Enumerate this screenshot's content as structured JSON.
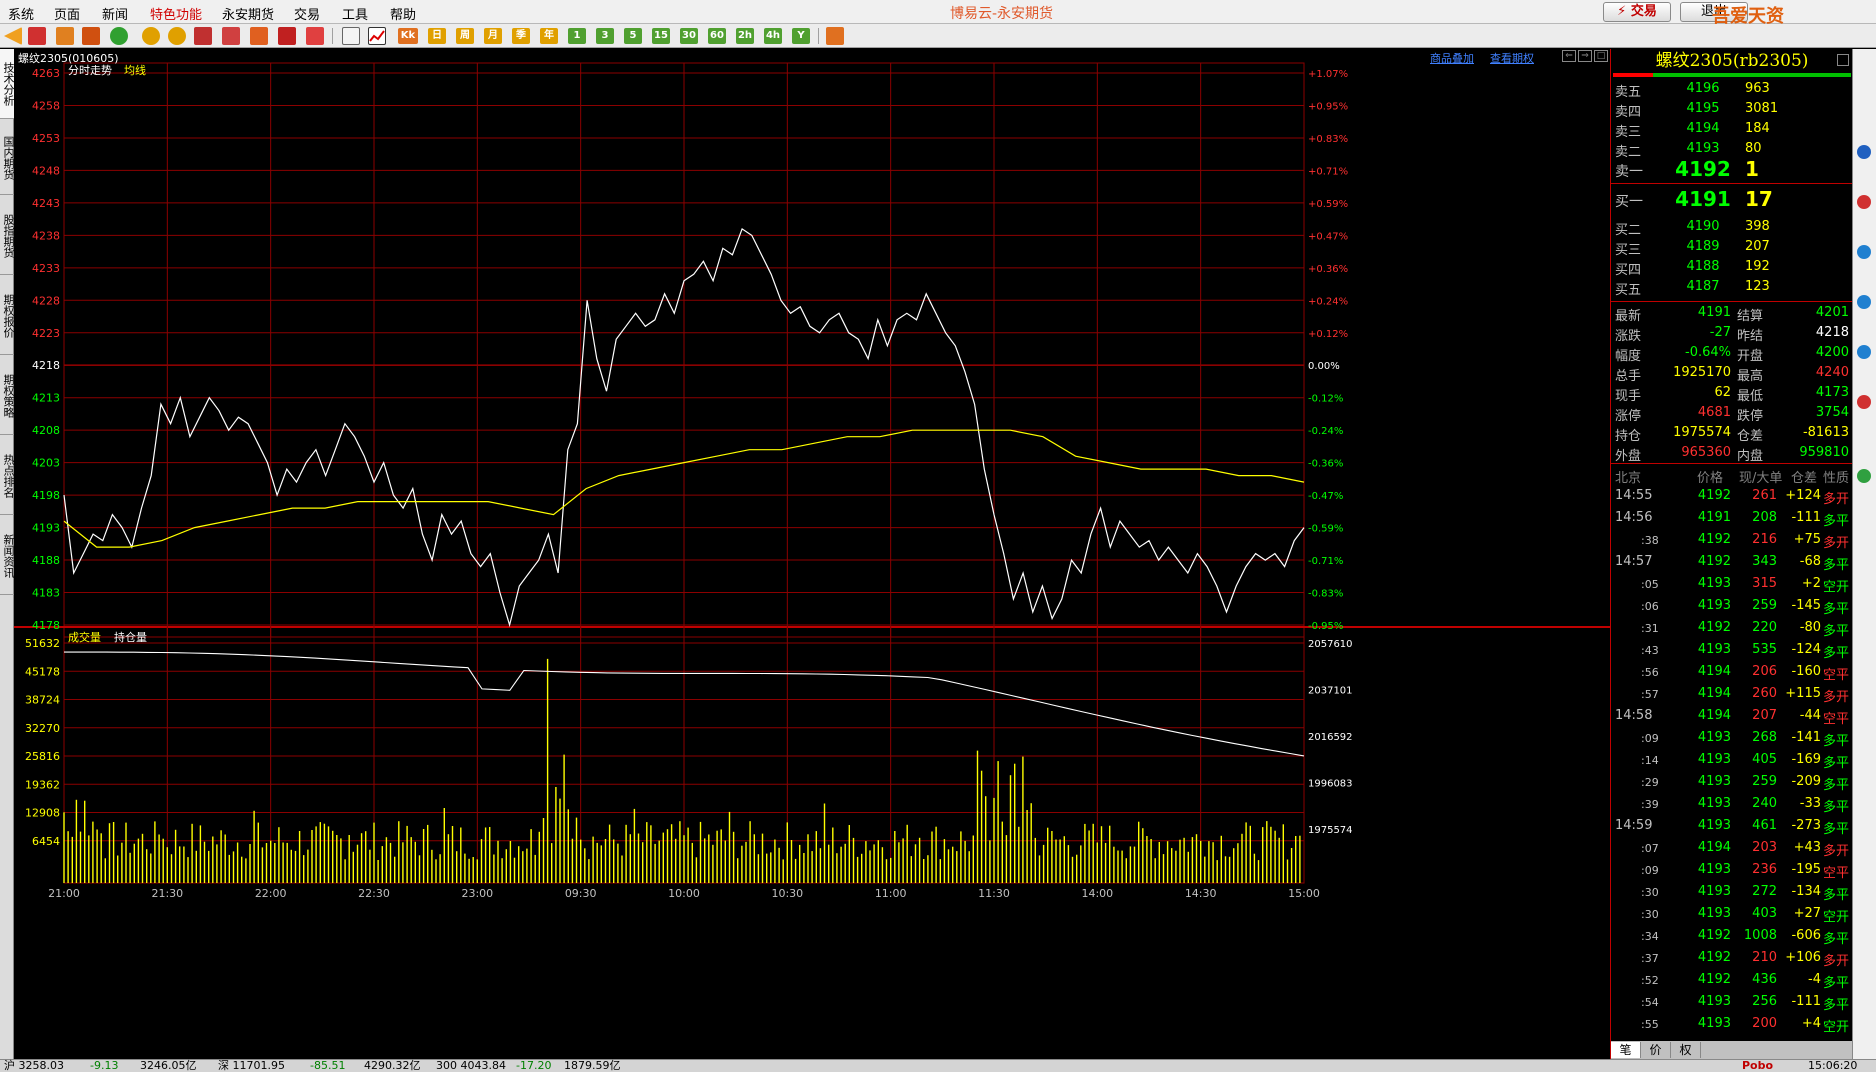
{
  "menu": {
    "items": [
      "系统",
      "页面",
      "新闻",
      "特色功能",
      "永安期货",
      "交易",
      "工具",
      "帮助"
    ],
    "active_index": 3
  },
  "app_title": "博易云-永安期货",
  "trade_button": "⚡ 交易",
  "user_button": "退出",
  "watermark": "吾爱天资5etz.com",
  "toolbar": {
    "icons": [
      "back-arrow-icon",
      "home-icon",
      "layers-icon",
      "table-icon",
      "refresh-icon",
      "zoom-in-icon",
      "zoom-out-icon",
      "window-icon",
      "pen-icon",
      "eraser-icon",
      "filter-icon",
      "bell-icon",
      "list-icon",
      "chart-line-icon",
      "kline-icon",
      "calendar-icon"
    ],
    "period_labels": [
      "日",
      "周",
      "月",
      "季",
      "年",
      "1",
      "3",
      "5",
      "15",
      "30",
      "60",
      "2h",
      "4h",
      "Y"
    ]
  },
  "left_tabs": [
    "技术分析",
    "国内期货",
    "股指期货",
    "期权报价",
    "期权策略",
    "热点排名",
    "新闻资讯"
  ],
  "chart": {
    "symbol_label": "螺纹2305(010605)",
    "links": [
      "商品叠加",
      "查看期权"
    ],
    "upper_legend": [
      "分时走势",
      "均线"
    ],
    "lower_legend": [
      "成交量",
      "持仓量"
    ],
    "price_ticks": [
      "4263",
      "4258",
      "4253",
      "4248",
      "4243",
      "4238",
      "4233",
      "4228",
      "4223",
      "4218",
      "4213",
      "4208",
      "4203",
      "4198",
      "4193",
      "4188",
      "4183",
      "4178"
    ],
    "pct_ticks": [
      "+1.07%",
      "+0.95%",
      "+0.83%",
      "+0.71%",
      "+0.59%",
      "+0.47%",
      "+0.36%",
      "+0.24%",
      "+0.12%",
      "0.00%",
      "-0.12%",
      "-0.24%",
      "-0.36%",
      "-0.47%",
      "-0.59%",
      "-0.71%",
      "-0.83%",
      "-0.95%"
    ],
    "vol_ticks": [
      "51632",
      "45178",
      "38724",
      "32270",
      "25816",
      "19362",
      "12908",
      "6454"
    ],
    "oi_ticks": [
      "2057610",
      "2037101",
      "2016592",
      "1996083",
      "1975574"
    ],
    "time_labels": [
      "21:00",
      "21:30",
      "22:00",
      "22:30",
      "23:00",
      "09:30",
      "10:00",
      "10:30",
      "11:00",
      "11:30",
      "14:00",
      "14:30",
      "15:00"
    ]
  },
  "chart_data": {
    "type": "line",
    "title": "螺纹2305(010605)",
    "prev_settle": 4218,
    "ylim": [
      4178,
      4263
    ],
    "series": [
      {
        "name": "分时走势",
        "values": [
          4198,
          4186,
          4189,
          4192,
          4191,
          4195,
          4193,
          4190,
          4196,
          4201,
          4212,
          4209,
          4213,
          4207,
          4210,
          4213,
          4211,
          4208,
          4210,
          4209,
          4206,
          4203,
          4198,
          4202,
          4200,
          4203,
          4205,
          4201,
          4205,
          4209,
          4207,
          4204,
          4200,
          4203,
          4198,
          4196,
          4199,
          4192,
          4188,
          4195,
          4192,
          4194,
          4189,
          4187,
          4189,
          4183,
          4178,
          4184,
          4186,
          4188,
          4192,
          4186,
          4205,
          4209,
          4228,
          4219,
          4214,
          4222,
          4224,
          4226,
          4224,
          4225,
          4229,
          4226,
          4231,
          4232,
          4234,
          4231,
          4236,
          4235,
          4239,
          4238,
          4235,
          4232,
          4228,
          4226,
          4227,
          4224,
          4223,
          4225,
          4226,
          4223,
          4222,
          4219,
          4225,
          4221,
          4225,
          4226,
          4225,
          4229,
          4226,
          4223,
          4221,
          4217,
          4212,
          4202,
          4195,
          4189,
          4182,
          4186,
          4180,
          4184,
          4179,
          4182,
          4188,
          4186,
          4192,
          4196,
          4190,
          4194,
          4192,
          4190,
          4191,
          4188,
          4190,
          4188,
          4186,
          4189,
          4187,
          4184,
          4180,
          4184,
          4187,
          4189,
          4188,
          4189,
          4187,
          4191,
          4193
        ]
      },
      {
        "name": "均线",
        "values": [
          4194,
          4190,
          4190,
          4191,
          4193,
          4194,
          4195,
          4196,
          4196,
          4197,
          4197,
          4197,
          4197,
          4197,
          4196,
          4195,
          4199,
          4201,
          4202,
          4203,
          4204,
          4205,
          4205,
          4206,
          4207,
          4207,
          4208,
          4208,
          4208,
          4208,
          4207,
          4204,
          4203,
          4202,
          4202,
          4202,
          4201,
          4201,
          4200
        ]
      }
    ],
    "volume_ylim": [
      0,
      51632
    ],
    "open_interest_ylim": [
      1975574,
      2057610
    ],
    "x_labels": [
      "21:00",
      "21:30",
      "22:00",
      "22:30",
      "23:00",
      "09:30",
      "10:00",
      "10:30",
      "11:00",
      "11:30",
      "14:00",
      "14:30",
      "15:00"
    ]
  },
  "quote": {
    "title": "螺纹2305(rb2305)",
    "asks": [
      {
        "label": "卖五",
        "price": "4196",
        "vol": "963"
      },
      {
        "label": "卖四",
        "price": "4195",
        "vol": "3081"
      },
      {
        "label": "卖三",
        "price": "4194",
        "vol": "184"
      },
      {
        "label": "卖二",
        "price": "4193",
        "vol": "80"
      },
      {
        "label": "卖一",
        "price": "4192",
        "vol": "1"
      }
    ],
    "bids": [
      {
        "label": "买一",
        "price": "4191",
        "vol": "17"
      },
      {
        "label": "买二",
        "price": "4190",
        "vol": "398"
      },
      {
        "label": "买三",
        "price": "4189",
        "vol": "207"
      },
      {
        "label": "买四",
        "price": "4188",
        "vol": "192"
      },
      {
        "label": "买五",
        "price": "4187",
        "vol": "123"
      }
    ],
    "stats": [
      {
        "l1": "最新",
        "v1": "4191",
        "c1": "#00ff00",
        "l2": "结算",
        "v2": "4201",
        "c2": "#00ff00"
      },
      {
        "l1": "涨跌",
        "v1": "-27",
        "c1": "#00ff00",
        "l2": "昨结",
        "v2": "4218",
        "c2": "#ffffff"
      },
      {
        "l1": "幅度",
        "v1": "-0.64%",
        "c1": "#00ff00",
        "l2": "开盘",
        "v2": "4200",
        "c2": "#00ff00"
      },
      {
        "l1": "总手",
        "v1": "1925170",
        "c1": "#ffff00",
        "l2": "最高",
        "v2": "4240",
        "c2": "#ff3030"
      },
      {
        "l1": "现手",
        "v1": "62",
        "c1": "#ffff00",
        "l2": "最低",
        "v2": "4173",
        "c2": "#00ff00"
      },
      {
        "l1": "涨停",
        "v1": "4681",
        "c1": "#ff3030",
        "l2": "跌停",
        "v2": "3754",
        "c2": "#00ff00"
      },
      {
        "l1": "持仓",
        "v1": "1975574",
        "c1": "#ffff00",
        "l2": "仓差",
        "v2": "-81613",
        "c2": "#ffff00"
      },
      {
        "l1": "外盘",
        "v1": "965360",
        "c1": "#ff3030",
        "l2": "内盘",
        "v2": "959810",
        "c2": "#00ff00"
      }
    ],
    "tick_header": [
      "北京",
      "价格",
      "现/大单",
      "仓差",
      "性质"
    ],
    "ticks": [
      {
        "time": "14:55",
        "full": true,
        "price": "4192",
        "pc": "#00ff00",
        "vol": "261",
        "vc": "#ff3030",
        "chg": "+124",
        "type": "多开",
        "tc": "#ff3030"
      },
      {
        "time": "14:56",
        "full": true,
        "price": "4191",
        "pc": "#00ff00",
        "vol": "208",
        "vc": "#00ff00",
        "chg": "-111",
        "type": "多平",
        "tc": "#00ff00"
      },
      {
        "time": ":38",
        "full": false,
        "price": "4192",
        "pc": "#00ff00",
        "vol": "216",
        "vc": "#ff3030",
        "chg": "+75",
        "type": "多开",
        "tc": "#ff3030"
      },
      {
        "time": "14:57",
        "full": true,
        "price": "4192",
        "pc": "#00ff00",
        "vol": "343",
        "vc": "#00ff00",
        "chg": "-68",
        "type": "多平",
        "tc": "#00ff00"
      },
      {
        "time": ":05",
        "full": false,
        "price": "4193",
        "pc": "#00ff00",
        "vol": "315",
        "vc": "#ff3030",
        "chg": "+2",
        "type": "空开",
        "tc": "#00ff00"
      },
      {
        "time": ":06",
        "full": false,
        "price": "4193",
        "pc": "#00ff00",
        "vol": "259",
        "vc": "#00ff00",
        "chg": "-145",
        "type": "多平",
        "tc": "#00ff00"
      },
      {
        "time": ":31",
        "full": false,
        "price": "4192",
        "pc": "#00ff00",
        "vol": "220",
        "vc": "#00ff00",
        "chg": "-80",
        "type": "多平",
        "tc": "#00ff00"
      },
      {
        "time": ":43",
        "full": false,
        "price": "4193",
        "pc": "#00ff00",
        "vol": "535",
        "vc": "#00ff00",
        "chg": "-124",
        "type": "多平",
        "tc": "#00ff00"
      },
      {
        "time": ":56",
        "full": false,
        "price": "4194",
        "pc": "#00ff00",
        "vol": "206",
        "vc": "#ff3030",
        "chg": "-160",
        "type": "空平",
        "tc": "#ff3030"
      },
      {
        "time": ":57",
        "full": false,
        "price": "4194",
        "pc": "#00ff00",
        "vol": "260",
        "vc": "#ff3030",
        "chg": "+115",
        "type": "多开",
        "tc": "#ff3030"
      },
      {
        "time": "14:58",
        "full": true,
        "price": "4194",
        "pc": "#00ff00",
        "vol": "207",
        "vc": "#ff3030",
        "chg": "-44",
        "type": "空平",
        "tc": "#ff3030"
      },
      {
        "time": ":09",
        "full": false,
        "price": "4193",
        "pc": "#00ff00",
        "vol": "268",
        "vc": "#00ff00",
        "chg": "-141",
        "type": "多平",
        "tc": "#00ff00"
      },
      {
        "time": ":14",
        "full": false,
        "price": "4193",
        "pc": "#00ff00",
        "vol": "405",
        "vc": "#00ff00",
        "chg": "-169",
        "type": "多平",
        "tc": "#00ff00"
      },
      {
        "time": ":29",
        "full": false,
        "price": "4193",
        "pc": "#00ff00",
        "vol": "259",
        "vc": "#00ff00",
        "chg": "-209",
        "type": "多平",
        "tc": "#00ff00"
      },
      {
        "time": ":39",
        "full": false,
        "price": "4193",
        "pc": "#00ff00",
        "vol": "240",
        "vc": "#00ff00",
        "chg": "-33",
        "type": "多平",
        "tc": "#00ff00"
      },
      {
        "time": "14:59",
        "full": true,
        "price": "4193",
        "pc": "#00ff00",
        "vol": "461",
        "vc": "#00ff00",
        "chg": "-273",
        "type": "多平",
        "tc": "#00ff00"
      },
      {
        "time": ":07",
        "full": false,
        "price": "4194",
        "pc": "#00ff00",
        "vol": "203",
        "vc": "#ff3030",
        "chg": "+43",
        "type": "多开",
        "tc": "#ff3030"
      },
      {
        "time": ":09",
        "full": false,
        "price": "4193",
        "pc": "#00ff00",
        "vol": "236",
        "vc": "#ff3030",
        "chg": "-195",
        "type": "空平",
        "tc": "#ff3030"
      },
      {
        "time": ":30",
        "full": false,
        "price": "4193",
        "pc": "#00ff00",
        "vol": "272",
        "vc": "#00ff00",
        "chg": "-134",
        "type": "多平",
        "tc": "#00ff00"
      },
      {
        "time": ":30",
        "full": false,
        "price": "4193",
        "pc": "#00ff00",
        "vol": "403",
        "vc": "#00ff00",
        "chg": "+27",
        "type": "空开",
        "tc": "#00ff00"
      },
      {
        "time": ":34",
        "full": false,
        "price": "4192",
        "pc": "#00ff00",
        "vol": "1008",
        "vc": "#00ff00",
        "chg": "-606",
        "type": "多平",
        "tc": "#00ff00"
      },
      {
        "time": ":37",
        "full": false,
        "price": "4192",
        "pc": "#00ff00",
        "vol": "210",
        "vc": "#ff3030",
        "chg": "+106",
        "type": "多开",
        "tc": "#ff3030"
      },
      {
        "time": ":52",
        "full": false,
        "price": "4192",
        "pc": "#00ff00",
        "vol": "436",
        "vc": "#00ff00",
        "chg": "-4",
        "type": "多平",
        "tc": "#00ff00"
      },
      {
        "time": ":54",
        "full": false,
        "price": "4193",
        "pc": "#00ff00",
        "vol": "256",
        "vc": "#00ff00",
        "chg": "-111",
        "type": "多平",
        "tc": "#00ff00"
      },
      {
        "time": ":55",
        "full": false,
        "price": "4193",
        "pc": "#00ff00",
        "vol": "200",
        "vc": "#ff3030",
        "chg": "+4",
        "type": "空开",
        "tc": "#00ff00"
      }
    ],
    "bottom_tabs": [
      "笔",
      "价",
      "权"
    ]
  },
  "statusbar": {
    "items": [
      "沪 3258.03",
      "-9.13",
      "3246.05亿",
      "深 11701.95",
      "-85.51",
      "4290.32亿",
      "300 4043.84",
      "-17.20",
      "1879.59亿"
    ],
    "right": "Pobo",
    "clock": "15:06:20"
  },
  "colors": {
    "grid": "#8b0000",
    "price_line": "#ffffff",
    "avg_line": "#ffff00",
    "volume_bar": "#ffff00",
    "oi_line": "#ffffff",
    "up": "#ff3030",
    "down": "#00ff00"
  }
}
